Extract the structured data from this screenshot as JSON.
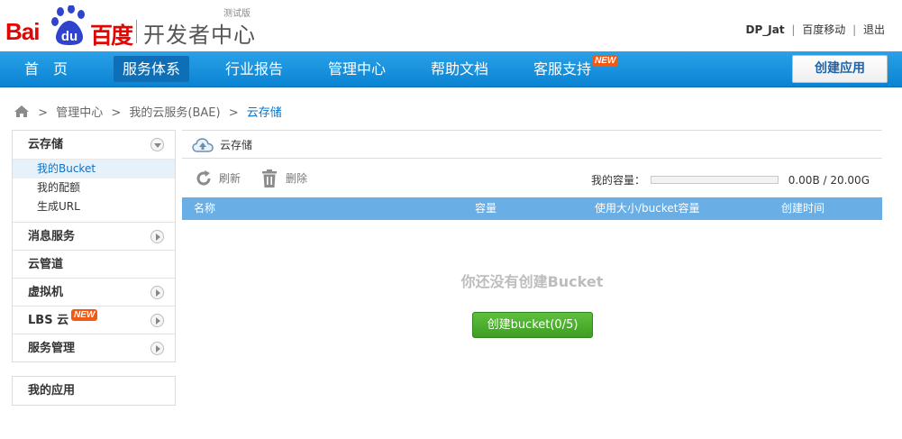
{
  "header": {
    "logo_latin": "Bai",
    "logo_du": "du",
    "logo_cn": "百度",
    "title": "开发者中心",
    "beta": "测试版",
    "username": "DP_Jat",
    "link_mobile": "百度移动",
    "link_logout": "退出",
    "separator": "|"
  },
  "nav": {
    "items": [
      "首　页",
      "服务体系",
      "行业报告",
      "管理中心",
      "帮助文档",
      "客服支持"
    ],
    "active_index": 1,
    "new_badge": "NEW",
    "create_app": "创建应用"
  },
  "breadcrumb": {
    "items": [
      "管理中心",
      "我的云服务(BAE)",
      "云存储"
    ],
    "sep": ">"
  },
  "sidebar": {
    "cloud_storage": "云存储",
    "sub_items": [
      "我的Bucket",
      "我的配额",
      "生成URL"
    ],
    "message_service": "消息服务",
    "cloud_pipe": "云管道",
    "vm": "虚拟机",
    "lbs": "LBS 云",
    "lbs_badge": "NEW",
    "service_mgmt": "服务管理",
    "my_apps": "我的应用"
  },
  "main": {
    "panel_title": "云存储",
    "refresh": "刷新",
    "delete": "删除",
    "capacity_label": "我的容量：",
    "capacity_used_fraction": 0,
    "capacity_value": "0.00B / 20.00G",
    "columns": [
      "名称",
      "容量",
      "使用大小/bucket容量",
      "创建时间"
    ],
    "empty_message": "你还没有创建Bucket",
    "create_bucket": "创建bucket(0/5)"
  },
  "colors": {
    "nav_bg": "#0a83d2",
    "brand_red": "#e10602",
    "table_header": "#6aaee6",
    "button_green": "#3d9e23",
    "badge_orange": "#f05a14"
  }
}
